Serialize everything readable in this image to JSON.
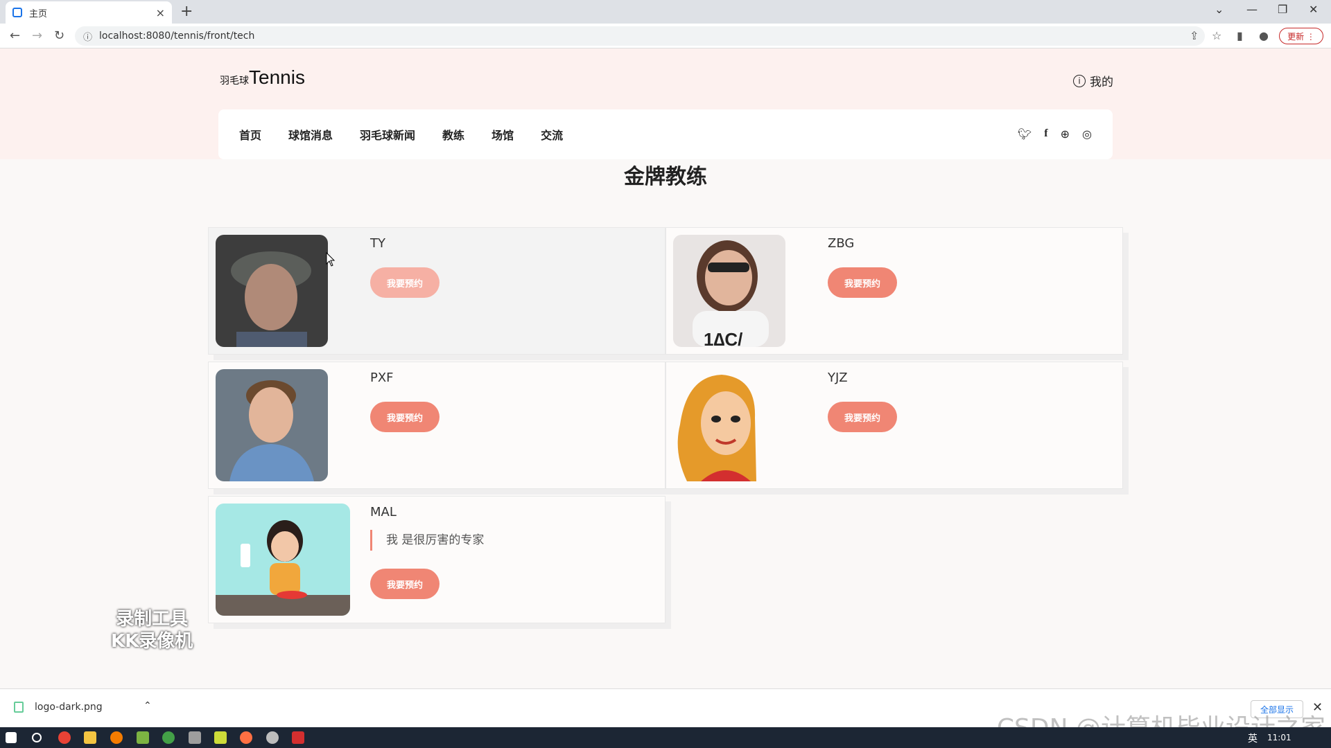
{
  "browser": {
    "tab_title": "主页",
    "tab_close": "×",
    "new_tab": "+",
    "url": "localhost:8080/tennis/front/tech",
    "update_label": "更新 ⋮",
    "win_min": "—",
    "win_restore": "❐",
    "win_close": "✕",
    "tab_list": "⌄"
  },
  "header": {
    "logo_small": "羽毛球",
    "logo_big": "Tennis",
    "mine_label": "我的",
    "nav": [
      "首页",
      "球馆消息",
      "羽毛球新闻",
      "教练",
      "场馆",
      "交流"
    ]
  },
  "page": {
    "title": "金牌教练"
  },
  "coaches": [
    {
      "name": "TY",
      "book_label": "我要预约",
      "photo_bg": "#4a4a4a"
    },
    {
      "name": "ZBG",
      "book_label": "我要预约",
      "photo_bg": "#e9e6e4"
    },
    {
      "name": "PXF",
      "book_label": "我要预约",
      "photo_bg": "#6c7b8a"
    },
    {
      "name": "YJZ",
      "book_label": "我要预约",
      "photo_bg": "#fdfbfa"
    },
    {
      "name": "MAL",
      "book_label": "我要预约",
      "quote": "我 是很厉害的专家",
      "photo_bg": "#a8e8e6"
    }
  ],
  "watermark": {
    "line1": "录制工具",
    "line2": "KK录像机"
  },
  "download": {
    "file": "logo-dark.png",
    "show_all": "全部显示",
    "close": "✕"
  },
  "csdn": "CSDN @计算机毕业设计之家",
  "taskbar": {
    "ime": "英",
    "time": "11:01"
  },
  "colors": {
    "accent": "#f08674",
    "header_bg": "#fdf1ef"
  }
}
